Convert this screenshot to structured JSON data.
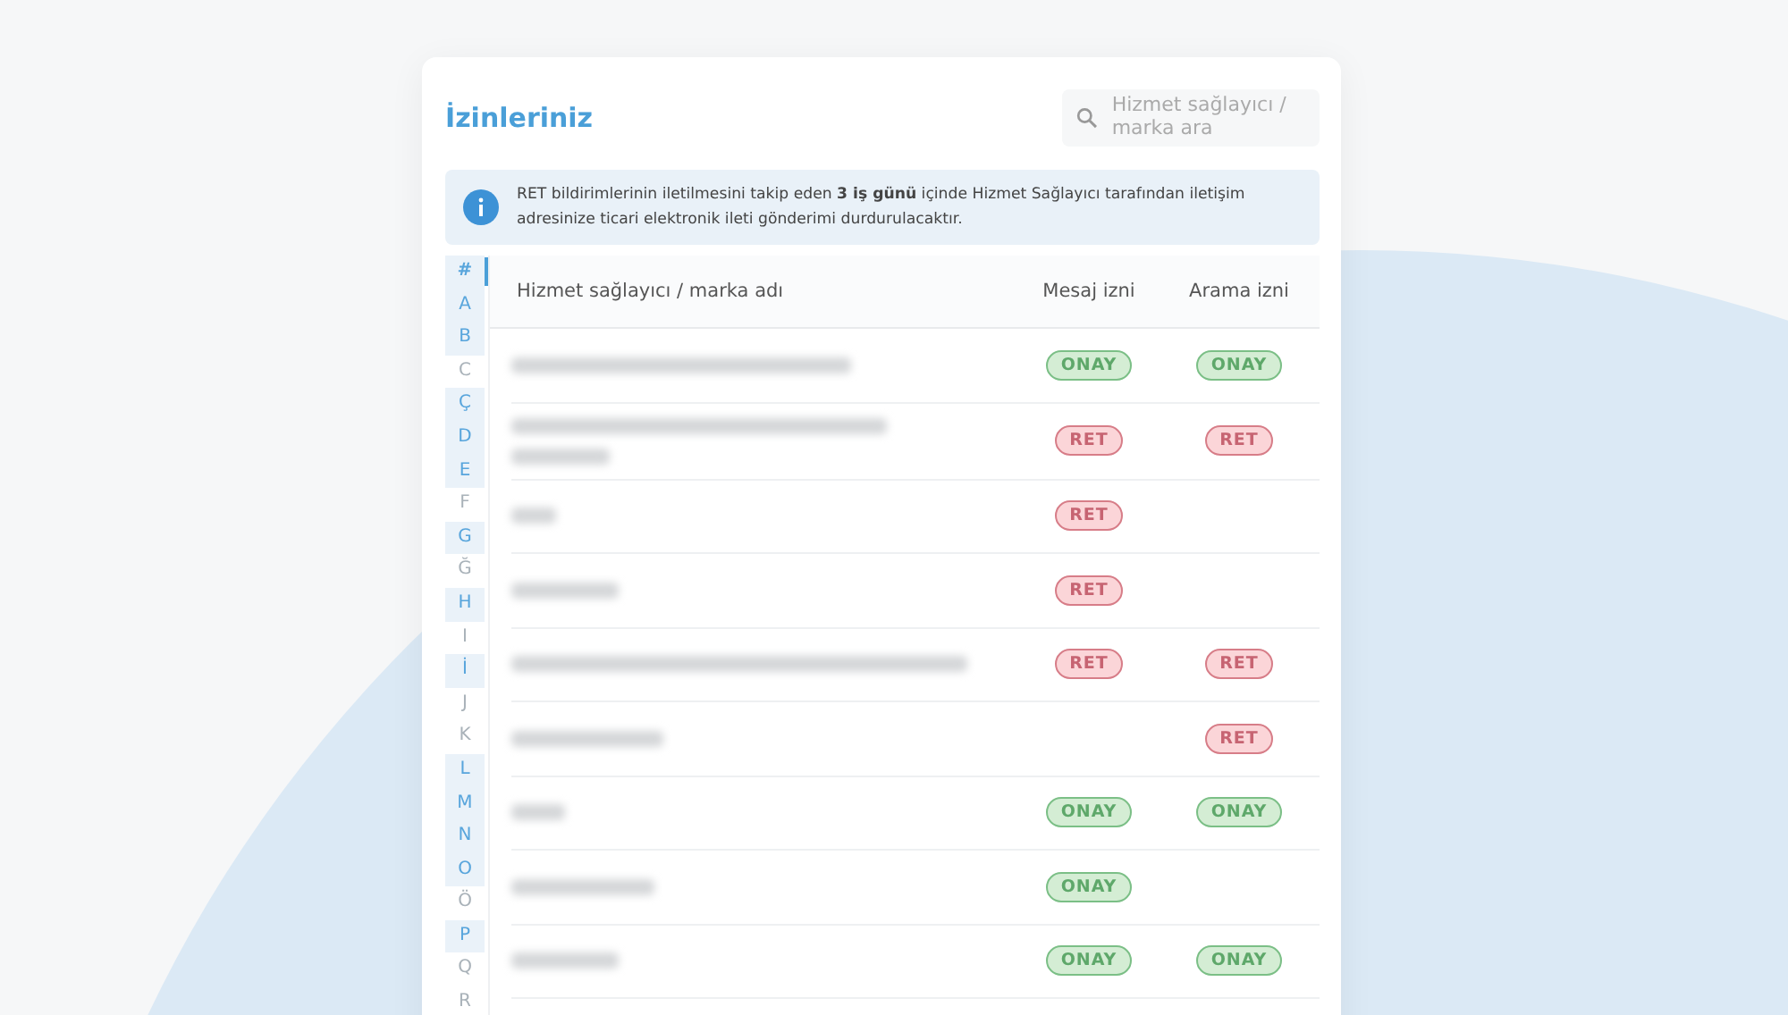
{
  "title": "İzinleriniz",
  "search": {
    "placeholder": "Hizmet sağlayıcı / marka ara"
  },
  "info": {
    "text": "RET bildirimlerinin iletilmesini takip eden **3 iş günü** içinde Hizmet Sağlayıcı tarafından iletişim adresinize ticari elektronik ileti gönderimi durdurulacaktır."
  },
  "alphabet": [
    {
      "letter": "#",
      "selected": true,
      "disabled": false
    },
    {
      "letter": "A",
      "selected": false,
      "disabled": false
    },
    {
      "letter": "B",
      "selected": false,
      "disabled": false
    },
    {
      "letter": "C",
      "selected": false,
      "disabled": true
    },
    {
      "letter": "Ç",
      "selected": false,
      "disabled": false
    },
    {
      "letter": "D",
      "selected": false,
      "disabled": false
    },
    {
      "letter": "E",
      "selected": false,
      "disabled": false
    },
    {
      "letter": "F",
      "selected": false,
      "disabled": true
    },
    {
      "letter": "G",
      "selected": false,
      "disabled": false
    },
    {
      "letter": "Ğ",
      "selected": false,
      "disabled": true
    },
    {
      "letter": "H",
      "selected": false,
      "disabled": false
    },
    {
      "letter": "I",
      "selected": false,
      "disabled": true
    },
    {
      "letter": "İ",
      "selected": false,
      "disabled": false
    },
    {
      "letter": "J",
      "selected": false,
      "disabled": true
    },
    {
      "letter": "K",
      "selected": false,
      "disabled": true
    },
    {
      "letter": "L",
      "selected": false,
      "disabled": false
    },
    {
      "letter": "M",
      "selected": false,
      "disabled": false
    },
    {
      "letter": "N",
      "selected": false,
      "disabled": false
    },
    {
      "letter": "O",
      "selected": false,
      "disabled": false
    },
    {
      "letter": "Ö",
      "selected": false,
      "disabled": true
    },
    {
      "letter": "P",
      "selected": false,
      "disabled": false
    },
    {
      "letter": "Q",
      "selected": false,
      "disabled": true
    },
    {
      "letter": "R",
      "selected": false,
      "disabled": true
    }
  ],
  "table": {
    "columns": [
      "Hizmet sağlayıcı / marka adı",
      "Mesaj izni",
      "Arama izni"
    ],
    "rows": [
      {
        "message": {
          "kind": "approve",
          "label": "ONAY"
        },
        "call": {
          "kind": "approve",
          "label": "ONAY"
        }
      },
      {
        "message": {
          "kind": "reject",
          "label": "RET"
        },
        "call": {
          "kind": "reject",
          "label": "RET"
        }
      },
      {
        "message": {
          "kind": "reject",
          "label": "RET"
        }
      },
      {
        "message": {
          "kind": "reject",
          "label": "RET"
        }
      },
      {
        "message": {
          "kind": "reject",
          "label": "RET"
        },
        "call": {
          "kind": "reject",
          "label": "RET"
        }
      },
      {
        "call": {
          "kind": "reject",
          "label": "RET"
        }
      },
      {
        "message": {
          "kind": "approve",
          "label": "ONAY"
        },
        "call": {
          "kind": "approve",
          "label": "ONAY"
        }
      },
      {
        "message": {
          "kind": "approve",
          "label": "ONAY"
        }
      },
      {
        "message": {
          "kind": "approve",
          "label": "ONAY"
        },
        "call": {
          "kind": "approve",
          "label": "ONAY"
        }
      },
      {}
    ]
  }
}
